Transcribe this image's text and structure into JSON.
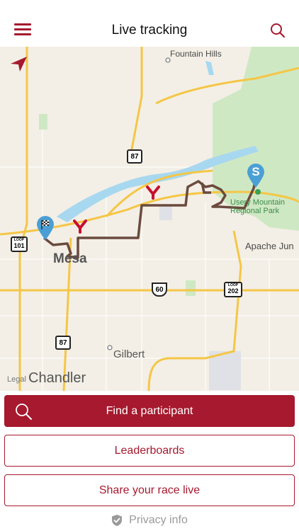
{
  "header": {
    "title": "Live tracking"
  },
  "map": {
    "labels": {
      "fountain_hills": "Fountain Hills",
      "usery_park_line1": "Usery Mountain",
      "usery_park_line2": "Regional Park",
      "apache_junction": "Apache Jun",
      "mesa": "Mesa",
      "gilbert": "Gilbert",
      "chandler": "Chandler",
      "legal": "Legal"
    },
    "shields": {
      "az87_north": "87",
      "az87_south": "87",
      "loop101": "101",
      "us60": "60",
      "loop202": "202",
      "loop_word": "LOOP"
    },
    "start_marker": "S"
  },
  "actions": {
    "find_participant": "Find a participant",
    "leaderboards": "Leaderboards",
    "share_race": "Share your race live"
  },
  "footer": {
    "privacy": "Privacy info"
  },
  "colors": {
    "brand": "#a6192e",
    "route": "#6b4a3e",
    "marker_blue": "#4a9fd5",
    "highway": "#f5c646",
    "water": "#a8d8ef",
    "park": "#cfe8c4"
  }
}
